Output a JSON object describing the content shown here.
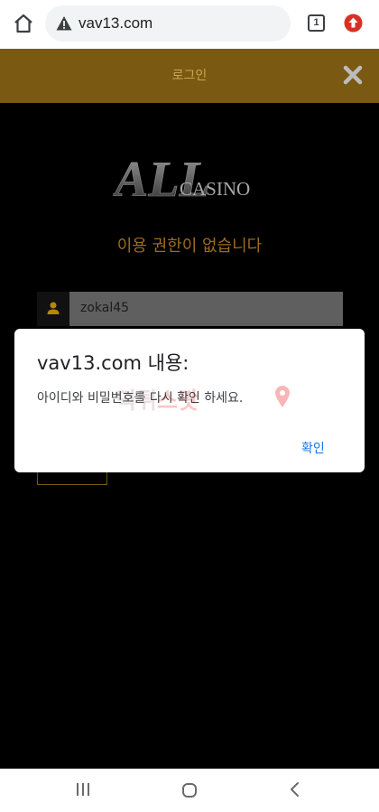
{
  "browser": {
    "url": "vav13.com",
    "tab_count": "1"
  },
  "site": {
    "header_title": "로그인",
    "logo_text": "ALLCASINO",
    "no_access_message": "이용 권한이 없습니다",
    "username_value": "zokal45"
  },
  "dialog": {
    "title": "vav13.com 내용:",
    "message": "아이디와 비밀번호를 다시 확인 하세요.",
    "ok_label": "확인",
    "watermark_part1": "먹튀",
    "watermark_part2": "스팟"
  },
  "colors": {
    "header_bg": "#7a5a12",
    "accent_gold": "#9a6d20",
    "dialog_button": "#1a73e8"
  },
  "icons": {
    "home": "home-icon",
    "warning": "warning-icon",
    "tabs": "tab-switcher-icon",
    "update": "update-arrow-icon",
    "close": "close-icon",
    "user": "user-icon",
    "nav_recents": "recents-icon",
    "nav_home": "nav-home-icon",
    "nav_back": "back-icon"
  }
}
